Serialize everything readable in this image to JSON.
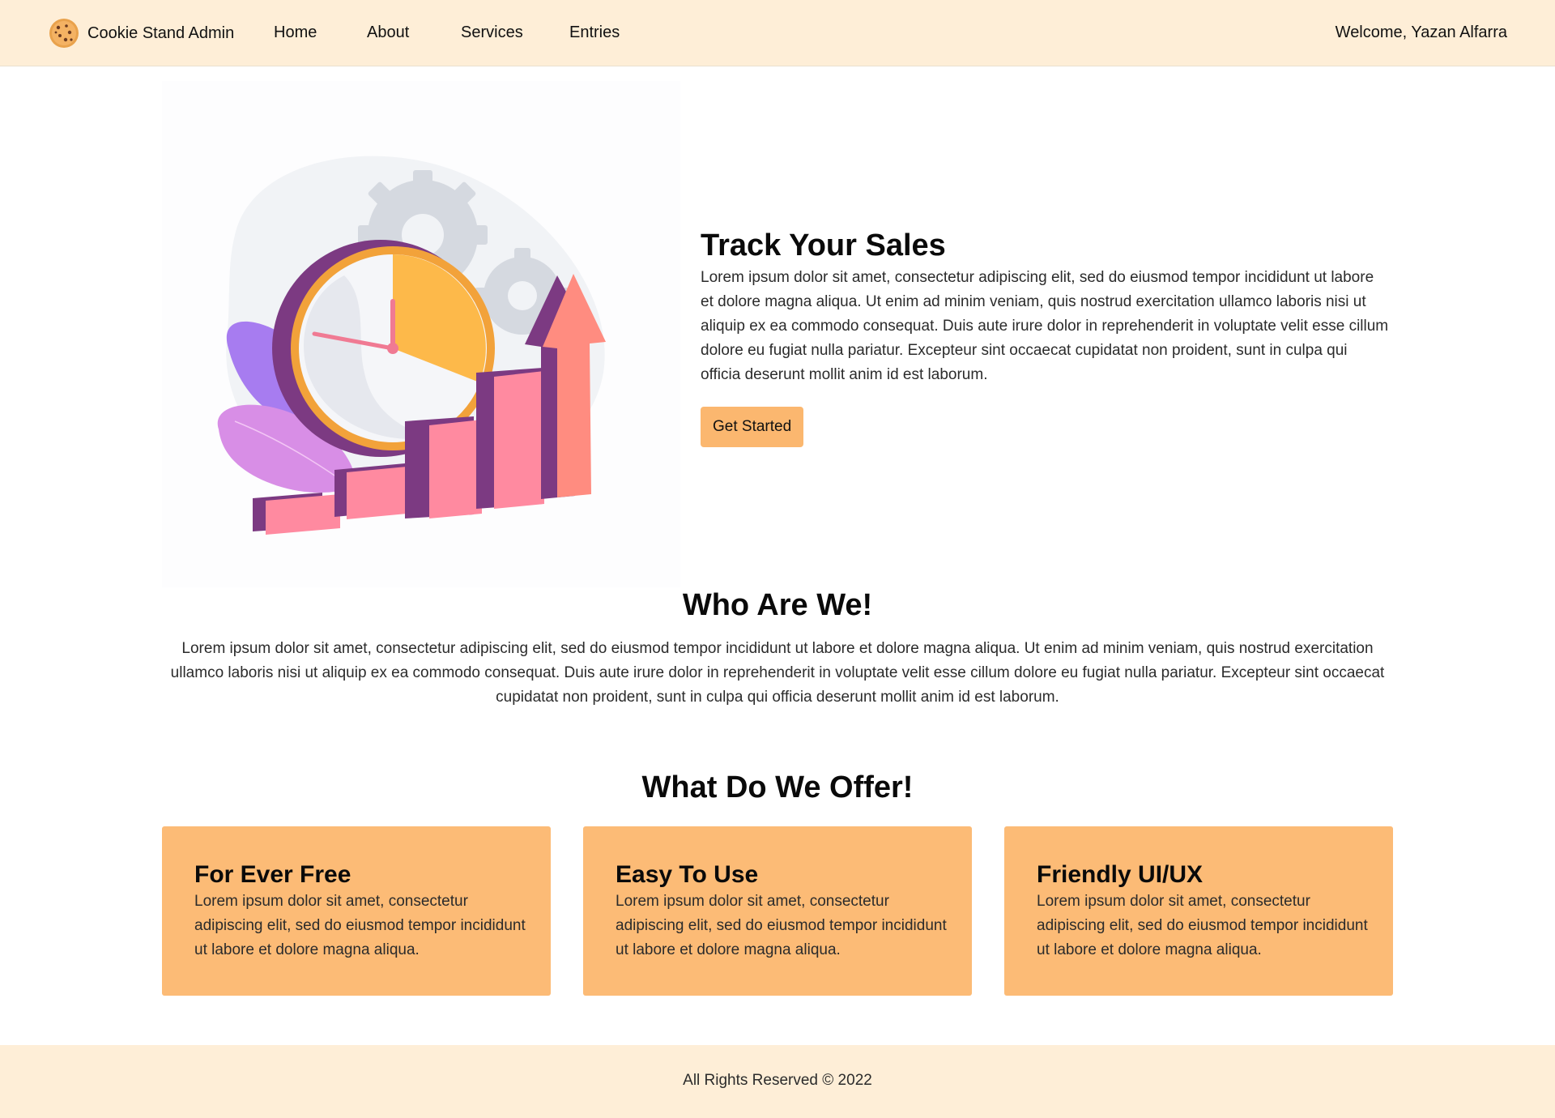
{
  "header": {
    "brand_name": "Cookie Stand Admin",
    "nav": {
      "home": "Home",
      "about": "About",
      "services": "Services",
      "entries": "Entries"
    },
    "welcome": "Welcome, Yazan Alfarra"
  },
  "hero": {
    "title": "Track Your Sales",
    "description": "Lorem ipsum dolor sit amet, consectetur adipiscing elit, sed do eiusmod tempor incididunt ut labore et dolore magna aliqua. Ut enim ad minim veniam, quis nostrud exercitation ullamco laboris nisi ut aliquip ex ea commodo consequat. Duis aute irure dolor in reprehenderit in voluptate velit esse cillum dolore eu fugiat nulla pariatur. Excepteur sint occaecat cupidatat non proident, sunt in culpa qui officia deserunt mollit anim id est laborum.",
    "cta_label": "Get Started",
    "illustration_icon": "sales-growth-illustration"
  },
  "who": {
    "title": "Who Are We!",
    "text": "Lorem ipsum dolor sit amet, consectetur adipiscing elit, sed do eiusmod tempor incididunt ut labore et dolore magna aliqua. Ut enim ad minim veniam, quis nostrud exercitation ullamco laboris nisi ut aliquip ex ea commodo consequat. Duis aute irure dolor in reprehenderit in voluptate velit esse cillum dolore eu fugiat nulla pariatur. Excepteur sint occaecat cupidatat non proident, sunt in culpa qui officia deserunt mollit anim id est laborum."
  },
  "offer": {
    "title": "What Do We Offer!",
    "cards": [
      {
        "title": "For Ever Free",
        "text": "Lorem ipsum dolor sit amet, consectetur adipiscing elit, sed do eiusmod tempor incididunt ut labore et dolore magna aliqua."
      },
      {
        "title": "Easy To Use",
        "text": "Lorem ipsum dolor sit amet, consectetur adipiscing elit, sed do eiusmod tempor incididunt ut labore et dolore magna aliqua."
      },
      {
        "title": "Friendly UI/UX",
        "text": "Lorem ipsum dolor sit amet, consectetur adipiscing elit, sed do eiusmod tempor incididunt ut labore et dolore magna aliqua."
      }
    ]
  },
  "footer": {
    "text": "All Rights Reserved © 2022"
  },
  "colors": {
    "header_bg": "#feeed7",
    "accent": "#fbb76f",
    "card_bg": "#fcbb76",
    "footer_bg": "#feeed7"
  }
}
